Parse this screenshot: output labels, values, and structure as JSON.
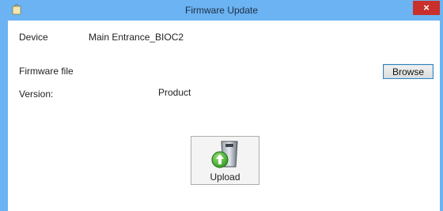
{
  "window": {
    "title": "Firmware Update",
    "close_label": "×"
  },
  "fields": {
    "device_label": "Device",
    "device_value": "Main Entrance_BIOC2",
    "firmware_file_label": "Firmware file",
    "version_label": "Version:",
    "version_value": "Product"
  },
  "buttons": {
    "browse_label": "Browse",
    "upload_label": "Upload"
  },
  "colors": {
    "titlebar": "#6bb3f2",
    "close": "#c9302c"
  }
}
